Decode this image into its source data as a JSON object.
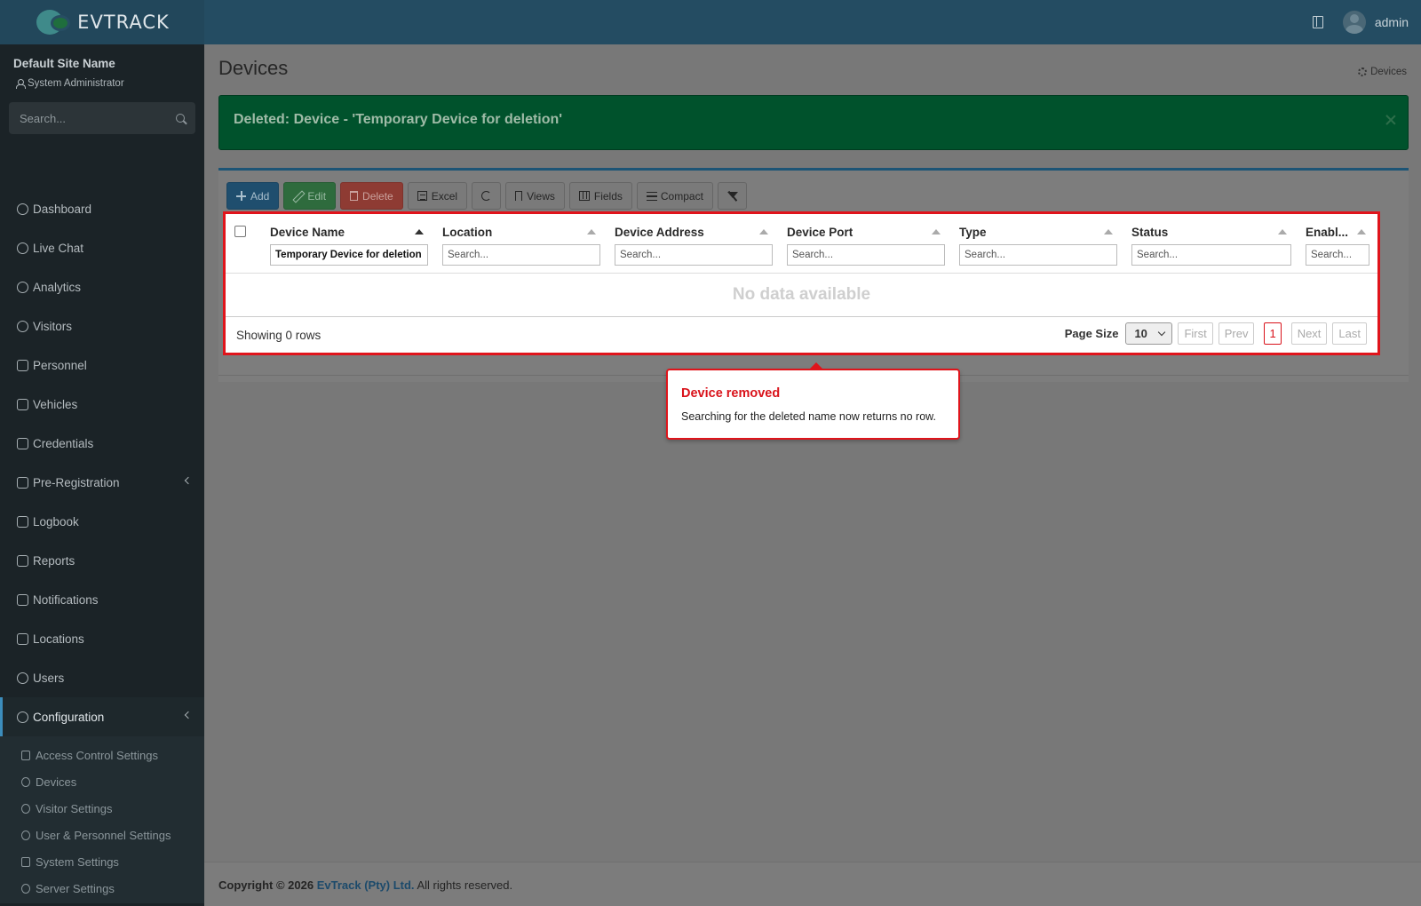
{
  "header": {
    "logo_text": "EVTRACK",
    "user_name": "admin"
  },
  "sidebar": {
    "site_name": "Default Site Name",
    "role": "System Administrator",
    "search_placeholder": "Search...",
    "items": [
      {
        "label": "Dashboard",
        "icon": "dashboard-icon"
      },
      {
        "label": "Live Chat",
        "icon": "headset-icon"
      },
      {
        "label": "Analytics",
        "icon": "target-icon"
      },
      {
        "label": "Visitors",
        "icon": "eye-icon"
      },
      {
        "label": "Personnel",
        "icon": "user-gear-icon"
      },
      {
        "label": "Vehicles",
        "icon": "car-icon"
      },
      {
        "label": "Credentials",
        "icon": "id-card-icon"
      },
      {
        "label": "Pre-Registration",
        "icon": "arrows-icon"
      },
      {
        "label": "Logbook",
        "icon": "book-icon"
      },
      {
        "label": "Reports",
        "icon": "chart-icon"
      },
      {
        "label": "Notifications",
        "icon": "chat-icon"
      },
      {
        "label": "Locations",
        "icon": "map-icon"
      },
      {
        "label": "Users",
        "icon": "users-icon"
      },
      {
        "label": "Configuration",
        "icon": "gear-icon"
      }
    ],
    "sub_items": [
      {
        "label": "Access Control Settings",
        "icon": "lock-icon"
      },
      {
        "label": "Devices",
        "icon": "gear-icon"
      },
      {
        "label": "Visitor Settings",
        "icon": "eye-icon"
      },
      {
        "label": "User & Personnel Settings",
        "icon": "users-icon"
      },
      {
        "label": "System Settings",
        "icon": "sliders-icon"
      },
      {
        "label": "Server Settings",
        "icon": "wrench-icon"
      }
    ]
  },
  "page": {
    "title": "Devices",
    "breadcrumb": "Devices"
  },
  "alert": {
    "message": "Deleted: Device - 'Temporary Device for deletion'"
  },
  "toolbar": {
    "add": "Add",
    "edit": "Edit",
    "delete": "Delete",
    "excel": "Excel",
    "views": "Views",
    "fields": "Fields",
    "compact": "Compact"
  },
  "grid": {
    "columns": [
      {
        "title": "Device Name",
        "filter_value": "Temporary Device for deletion",
        "placeholder": "Search..."
      },
      {
        "title": "Location",
        "filter_value": "",
        "placeholder": "Search..."
      },
      {
        "title": "Device Address",
        "filter_value": "",
        "placeholder": "Search..."
      },
      {
        "title": "Device Port",
        "filter_value": "",
        "placeholder": "Search..."
      },
      {
        "title": "Type",
        "filter_value": "",
        "placeholder": "Search..."
      },
      {
        "title": "Status",
        "filter_value": "",
        "placeholder": "Search..."
      },
      {
        "title": "Enabl...",
        "filter_value": "",
        "placeholder": "Search..."
      }
    ],
    "empty_message": "No data available",
    "showing": "Showing 0 rows",
    "page_size_label": "Page Size",
    "page_size": "10",
    "pager": {
      "first": "First",
      "prev": "Prev",
      "current": "1",
      "next": "Next",
      "last": "Last"
    }
  },
  "callout": {
    "title": "Device removed",
    "body": "Searching for the deleted name now returns no row."
  },
  "footer": {
    "prefix": "Copyright © 2026",
    "company": "EvTrack (Pty) Ltd.",
    "suffix": "All rights reserved."
  }
}
